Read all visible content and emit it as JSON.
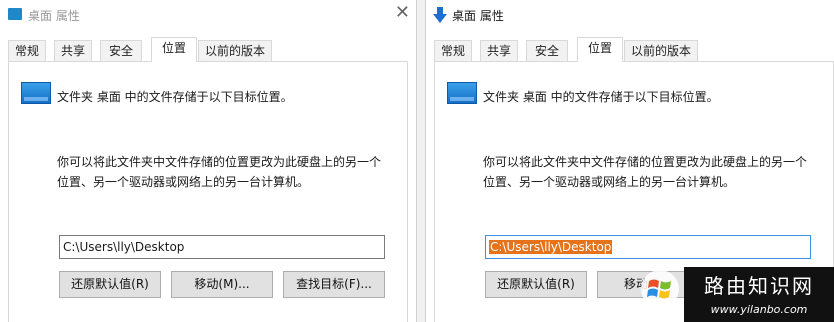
{
  "left_window": {
    "title": "桌面 属性",
    "close_glyph": "✕",
    "tabs": [
      "常规",
      "共享",
      "安全",
      "位置",
      "以前的版本"
    ],
    "active_tab": "位置",
    "description": "文件夹 桌面 中的文件存储于以下目标位置。",
    "paragraph_line1": "你可以将此文件夹中文件存储的位置更改为此硬盘上的另一个",
    "paragraph_line2": "位置、另一个驱动器或网络上的另一台计算机。",
    "path_value": "C:\\Users\\lly\\Desktop",
    "buttons": {
      "restore": "还原默认值(R)",
      "move": "移动(M)...",
      "find_target": "查找目标(F)..."
    }
  },
  "right_window": {
    "title": "桌面 属性",
    "tabs": [
      "常规",
      "共享",
      "安全",
      "位置",
      "以前的版本"
    ],
    "active_tab": "位置",
    "description": "文件夹 桌面 中的文件存储于以下目标位置。",
    "paragraph_line1": "你可以将此文件夹中文件存储的位置更改为此硬盘上的另一个",
    "paragraph_line2": "位置、另一个驱动器或网络上的另一台计算机。",
    "path_value": "C:\\Users\\lly\\Desktop",
    "buttons": {
      "restore": "还原默认值(R)",
      "move": "移动"
    }
  },
  "watermark": {
    "title": "路由知识网",
    "url": "www.yilanbo.com"
  },
  "colors": {
    "selection": "#e5731c",
    "folder_icon": "#1e88c8",
    "focus_border": "#3b8ee0"
  }
}
